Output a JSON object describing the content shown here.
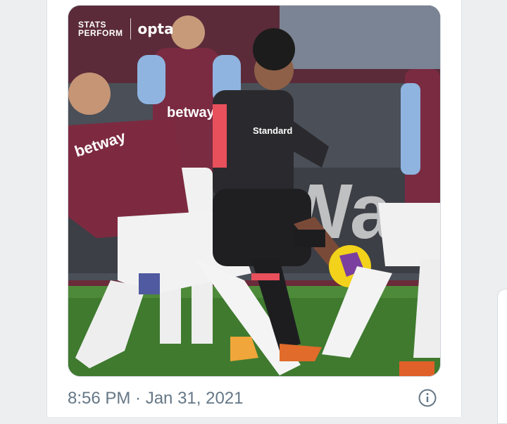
{
  "media": {
    "brand_stats": "STATS",
    "brand_perform": "PERFORM",
    "brand_opta": "opta",
    "shirt_sponsor_home": "betway",
    "shirt_sponsor_away": "Standard",
    "ad_board": "Wa"
  },
  "tweet": {
    "timestamp": "8:56 PM · Jan 31, 2021"
  },
  "icons": {
    "info": "info-icon"
  }
}
